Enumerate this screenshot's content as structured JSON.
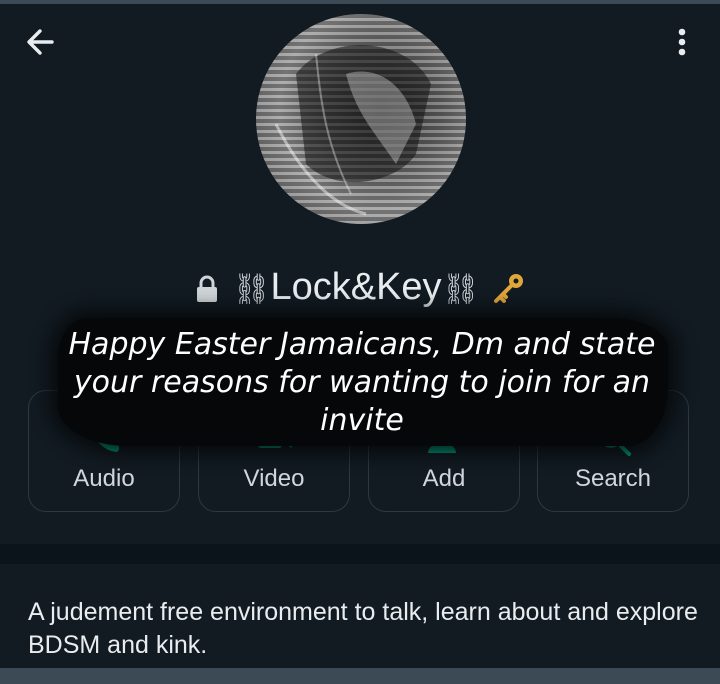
{
  "header": {
    "back_icon": "arrow-left-icon",
    "menu_icon": "more-vert-icon"
  },
  "group": {
    "name_prefix_icon": "lock-icon",
    "chain_glyph": "⛓",
    "name": "Lock&Key",
    "name_suffix_icon": "key-icon"
  },
  "caption": {
    "text": "Happy Easter Jamaicans, Dm and state your reasons for wanting to join for an invite"
  },
  "actions": [
    {
      "label": "Audio",
      "icon": "phone-icon"
    },
    {
      "label": "Video",
      "icon": "video-icon"
    },
    {
      "label": "Add",
      "icon": "add-person-icon"
    },
    {
      "label": "Search",
      "icon": "search-icon"
    }
  ],
  "description": {
    "text": "A judement free environment to talk, learn about and explore BDSM and kink."
  },
  "colors": {
    "background": "#0b141a",
    "panel": "#121b22",
    "accent": "#00a884",
    "text": "#e9edef"
  }
}
